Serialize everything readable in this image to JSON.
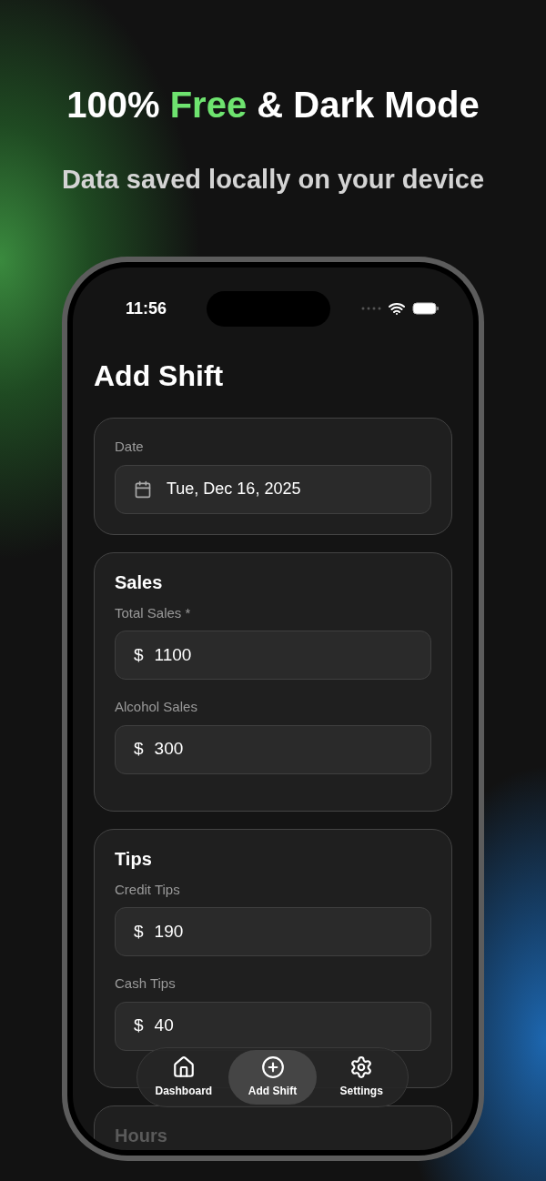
{
  "headline": [
    {
      "text": "100% ",
      "highlight": false
    },
    {
      "text": "Free",
      "highlight": true
    },
    {
      "text": " & Dark Mode",
      "highlight": false
    }
  ],
  "subtitle": "Data saved locally on your device",
  "status_bar": {
    "time": "11:56"
  },
  "screen": {
    "title": "Add Shift",
    "cards": [
      {
        "fields": [
          {
            "kind": "date",
            "label": "Date",
            "value": "Tue, Dec 16, 2025"
          }
        ]
      },
      {
        "title": "Sales",
        "fields": [
          {
            "kind": "money",
            "label": "Total Sales *",
            "prefix": "$",
            "value": "1100"
          },
          {
            "kind": "money",
            "label": "Alcohol Sales",
            "prefix": "$",
            "value": "300"
          }
        ]
      },
      {
        "title": "Tips",
        "fields": [
          {
            "kind": "money",
            "label": "Credit Tips",
            "prefix": "$",
            "value": "190"
          },
          {
            "kind": "money",
            "label": "Cash Tips",
            "prefix": "$",
            "value": "40"
          }
        ]
      },
      {
        "title": "Hours"
      }
    ]
  },
  "tab_bar": [
    {
      "kind": "home",
      "label": "Dashboard",
      "selected": false
    },
    {
      "kind": "add",
      "label": "Add Shift",
      "selected": true
    },
    {
      "kind": "settings",
      "label": "Settings",
      "selected": false
    }
  ]
}
